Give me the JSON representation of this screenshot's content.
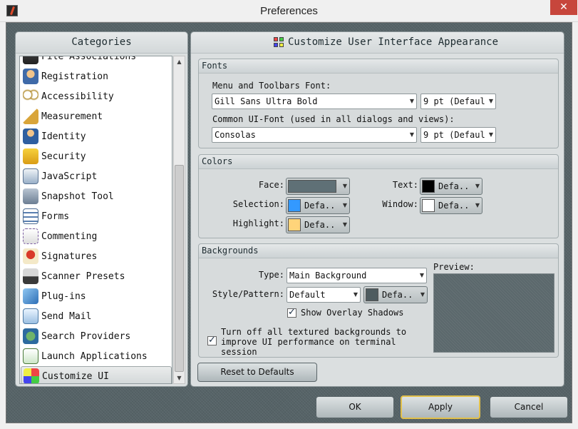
{
  "window": {
    "title": "Preferences",
    "close_label": "✕"
  },
  "categories": {
    "title": "Categories",
    "items": [
      {
        "label": "File Associations",
        "icon": "file-associations-icon"
      },
      {
        "label": "Registration",
        "icon": "registration-icon"
      },
      {
        "label": "Accessibility",
        "icon": "accessibility-icon"
      },
      {
        "label": "Measurement",
        "icon": "measurement-icon"
      },
      {
        "label": "Identity",
        "icon": "identity-icon"
      },
      {
        "label": "Security",
        "icon": "security-icon"
      },
      {
        "label": "JavaScript",
        "icon": "javascript-icon"
      },
      {
        "label": "Snapshot Tool",
        "icon": "snapshot-tool-icon"
      },
      {
        "label": "Forms",
        "icon": "forms-icon"
      },
      {
        "label": "Commenting",
        "icon": "commenting-icon"
      },
      {
        "label": "Signatures",
        "icon": "signatures-icon"
      },
      {
        "label": "Scanner Presets",
        "icon": "scanner-presets-icon"
      },
      {
        "label": "Plug-ins",
        "icon": "plug-ins-icon"
      },
      {
        "label": "Send Mail",
        "icon": "send-mail-icon"
      },
      {
        "label": "Search Providers",
        "icon": "search-providers-icon"
      },
      {
        "label": "Launch Applications",
        "icon": "launch-applications-icon"
      },
      {
        "label": "Customize UI",
        "icon": "customize-ui-icon",
        "selected": true
      }
    ]
  },
  "customize": {
    "title": "Customize User Interface Appearance",
    "fonts": {
      "title": "Fonts",
      "menu_font_label": "Menu and Toolbars Font:",
      "menu_font_value": "Gill Sans Ultra Bold",
      "menu_font_size": "9 pt (Defaul",
      "common_font_label": "Common UI-Font (used in all dialogs and views):",
      "common_font_value": "Consolas",
      "common_font_size": "9 pt (Defaul"
    },
    "colors": {
      "title": "Colors",
      "face_label": "Face:",
      "face_color": "#5f7076",
      "text_label": "Text:",
      "text_value": "Defa..",
      "text_color": "#000000",
      "selection_label": "Selection:",
      "selection_value": "Defa..",
      "selection_color": "#3399ff",
      "window_label": "Window:",
      "window_value": "Defa..",
      "window_color": "#ffffff",
      "highlight_label": "Highlight:",
      "highlight_value": "Defa..",
      "highlight_color": "#ffd47a"
    },
    "backgrounds": {
      "title": "Backgrounds",
      "type_label": "Type:",
      "type_value": "Main Background",
      "style_label": "Style/Pattern:",
      "style_value": "Default",
      "pattern_color_value": "Defa..",
      "pattern_color": "#4e5c60",
      "overlay_label": "Show Overlay Shadows",
      "overlay_checked": true,
      "turn_off_label_1": "Turn off all textured backgrounds to",
      "turn_off_label_2": "improve UI performance on terminal",
      "turn_off_label_3": "session",
      "turn_off_checked": true,
      "preview_label": "Preview:"
    },
    "reset_label": "Reset to Defaults"
  },
  "footer": {
    "ok_label": "OK",
    "apply_label": "Apply",
    "cancel_label": "Cancel"
  }
}
